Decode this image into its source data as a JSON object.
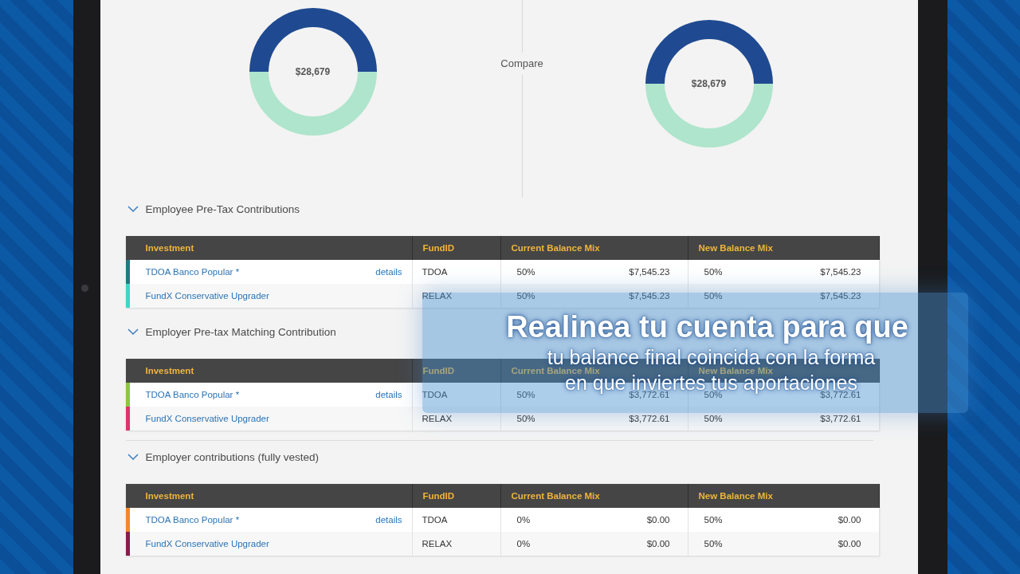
{
  "summary": {
    "compare_label": "Compare",
    "donuts": [
      {
        "value": "$28,679"
      },
      {
        "value": "$28,679"
      }
    ]
  },
  "sections": [
    {
      "title": "Employee Pre-Tax Contributions",
      "expanded": true,
      "columns": [
        "Investment",
        "FundID",
        "Current Balance Mix",
        "New Balance Mix"
      ],
      "rows": [
        {
          "color": "#1f7a80",
          "investment": "TDOA Banco Popular *",
          "details": "details",
          "fund_id": "TDOA",
          "current_pct": "50%",
          "current_amount": "$7,545.23",
          "new_pct": "50%",
          "new_amount": "$7,545.23"
        },
        {
          "color": "#3fd6c6",
          "investment": "FundX Conservative Upgrader",
          "fund_id": "RELAX",
          "current_pct": "50%",
          "current_amount": "$7,545.23",
          "new_pct": "50%",
          "new_amount": "$7,545.23"
        }
      ]
    },
    {
      "title": "Employer Pre-tax Matching Contribution",
      "expanded": true,
      "columns": [
        "Investment",
        "FundID",
        "Current Balance Mix",
        "New Balance Mix"
      ],
      "rows": [
        {
          "color": "#8cc63f",
          "investment": "TDOA Banco Popular *",
          "details": "details",
          "fund_id": "TDOA",
          "current_pct": "50%",
          "current_amount": "$3,772.61",
          "new_pct": "50%",
          "new_amount": "$3,772.61"
        },
        {
          "color": "#e0336b",
          "investment": "FundX Conservative Upgrader",
          "fund_id": "RELAX",
          "current_pct": "50%",
          "current_amount": "$3,772.61",
          "new_pct": "50%",
          "new_amount": "$3,772.61"
        }
      ]
    },
    {
      "title": "Employer contributions (fully vested)",
      "expanded": true,
      "columns": [
        "Investment",
        "FundID",
        "Current Balance Mix",
        "New Balance Mix"
      ],
      "rows": [
        {
          "color": "#f5862b",
          "investment": "TDOA Banco Popular *",
          "details": "details",
          "fund_id": "TDOA",
          "current_pct": "0%",
          "current_amount": "$0.00",
          "new_pct": "50%",
          "new_amount": "$0.00"
        },
        {
          "color": "#8b1a4a",
          "investment": "FundX Conservative Upgrader",
          "fund_id": "RELAX",
          "current_pct": "0%",
          "current_amount": "$0.00",
          "new_pct": "50%",
          "new_amount": "$0.00"
        }
      ]
    }
  ],
  "caption": {
    "title": "Realinea tu cuenta para que",
    "lines": [
      "tu balance final coincida con la forma",
      "en que inviertes tus aportaciones"
    ]
  }
}
